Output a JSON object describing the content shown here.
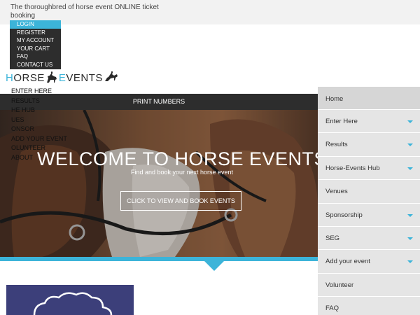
{
  "header": {
    "tagline": "The thoroughbred of horse event ONLINE ticket booking"
  },
  "user_links": [
    {
      "label": "LOGIN",
      "active": true
    },
    {
      "label": "REGISTER",
      "active": false
    },
    {
      "label": "MY ACCOUNT",
      "active": false
    },
    {
      "label": "YOUR CART",
      "active": false
    },
    {
      "label": "FAQ",
      "active": false
    },
    {
      "label": "CONTACT US",
      "active": false
    }
  ],
  "logo": {
    "part1_first": "H",
    "part1_rest": "ORSE",
    "part2_first": "E",
    "part2_rest": "VENTS",
    "icon": "horse-rider-icon"
  },
  "mobile_menu": [
    "ENTER HERE",
    "RESULTS",
    "HE HUB",
    "UES",
    "ONSOR",
    "ADD YOUR EVENT",
    "OLUNTEER",
    "ABOUT"
  ],
  "print_bar": {
    "label": "PRINT NUMBERS"
  },
  "hero": {
    "title": "WELCOME TO HORSE EVENTS",
    "subtitle": "Find and book your next horse event",
    "button": "CLICK TO VIEW AND BOOK EVENTS"
  },
  "sidenav": [
    {
      "label": "Home",
      "has_caret": false
    },
    {
      "label": "Enter Here",
      "has_caret": true
    },
    {
      "label": "Results",
      "has_caret": true
    },
    {
      "label": "Horse-Events Hub",
      "has_caret": true
    },
    {
      "label": "Venues",
      "has_caret": false
    },
    {
      "label": "Sponsorship",
      "has_caret": true
    },
    {
      "label": "SEG",
      "has_caret": true
    },
    {
      "label": "Add your event",
      "has_caret": true
    },
    {
      "label": "Volunteer",
      "has_caret": false
    },
    {
      "label": "FAQ",
      "has_caret": false
    }
  ],
  "colors": {
    "accent": "#3cb4d9",
    "dark": "#2d2d2d",
    "nav_bg": "#e5e5e5",
    "promo_bg": "#3c3f7a"
  }
}
